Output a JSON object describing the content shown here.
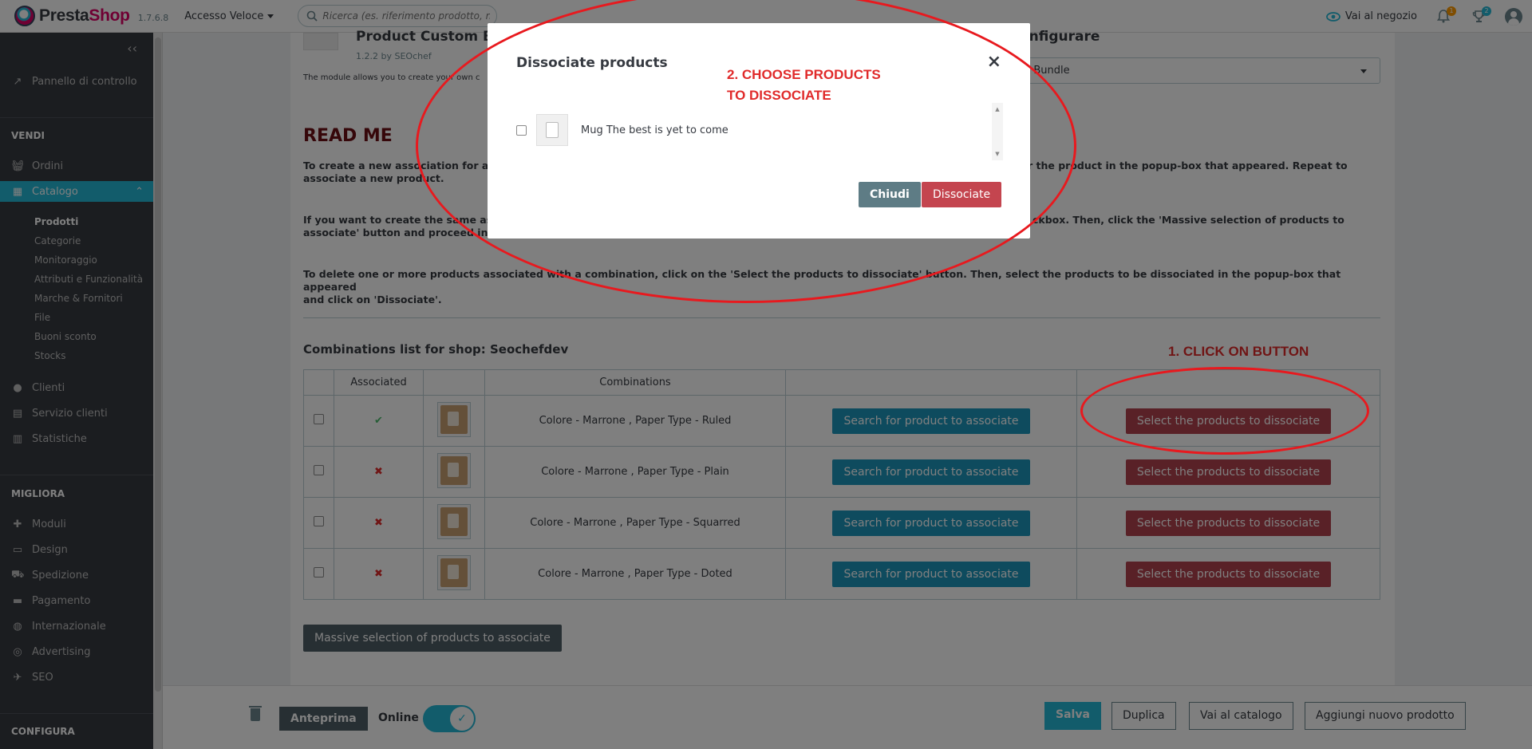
{
  "header": {
    "brand_a": "Presta",
    "brand_b": "Shop",
    "version": "1.7.6.8",
    "quick_access": "Accesso Veloce",
    "search_placeholder": "Ricerca (es. riferimento prodotto, nome",
    "visit_store": "Vai al negozio",
    "notif_orders_count": "1",
    "notif_customers_count": "2"
  },
  "sidebar": {
    "dashboard": "Pannello di controllo",
    "section_sell": "VENDI",
    "orders": "Ordini",
    "catalog": "Catalogo",
    "catalog_sub": [
      "Prodotti",
      "Categorie",
      "Monitoraggio",
      "Attributi e Funzionalità",
      "Marche & Fornitori",
      "File",
      "Buoni sconto",
      "Stocks"
    ],
    "customers": "Clienti",
    "customer_service": "Servizio clienti",
    "stats": "Statistiche",
    "section_improve": "MIGLIORA",
    "modules": "Moduli",
    "design": "Design",
    "shipping": "Spedizione",
    "payment": "Pagamento",
    "international": "Internazionale",
    "advertising": "Advertising",
    "seo": "SEO",
    "section_configure": "CONFIGURA"
  },
  "module": {
    "title": "Product Custom Bu",
    "version": "1.2.2 by SEOchef",
    "description": "The module allows you to create your own c",
    "configure_title": "onfigurare",
    "configure_select": "n Bundle",
    "readme": "READ ME",
    "para1_line1": "To create a new association for a",
    "para1_line1_right": "r the product in the popup-box that appeared. Repeat to",
    "para1_line2": "associate a new product.",
    "para2_line1": "If you want to create the same as",
    "para2_line1_right": "ckbox. Then, click the 'Massive selection of products to",
    "para2_line2": "associate' button and proceed in",
    "para3_line1": "To delete one or more products associated with a combination, click on the 'Select the products to dissociate' button. Then, select the products to be dissociated in the popup-box that appeared",
    "para3_line2": "and click on 'Dissociate'.",
    "combinations_title": "Combinations list for shop: Seochefdev",
    "annotation_1": "1. CLICK ON BUTTON",
    "columns": [
      "",
      "Associated",
      "",
      "Combinations",
      "",
      ""
    ],
    "rows": [
      {
        "combination": "Colore - Marrone ,  Paper Type - Ruled",
        "associated": true
      },
      {
        "combination": "Colore - Marrone ,  Paper Type - Plain",
        "associated": false
      },
      {
        "combination": "Colore - Marrone ,  Paper Type - Squarred",
        "associated": false
      },
      {
        "combination": "Colore - Marrone ,  Paper Type - Doted",
        "associated": false
      }
    ],
    "search_btn": "Search for product to associate",
    "dissociate_btn": "Select the products to dissociate",
    "massive_btn": "Massive selection of products to associate"
  },
  "footer": {
    "preview": "Anteprima",
    "online": "Online",
    "save": "Salva",
    "duplicate": "Duplica",
    "go_catalog": "Vai al catalogo",
    "add_new": "Aggiungi nuovo prodotto"
  },
  "modal": {
    "title": "Dissociate products",
    "annotation_2_line1": "2. CHOOSE PRODUCTS",
    "annotation_2_line2": "TO DISSOCIATE",
    "product_name": "Mug The best is yet to come",
    "close_btn": "Chiudi",
    "dissociate_btn": "Dissociate",
    "close_icon": "×"
  },
  "colors": {
    "primary": "#25b9d7",
    "danger": "#b3434f",
    "annotation": "#e8191e"
  }
}
